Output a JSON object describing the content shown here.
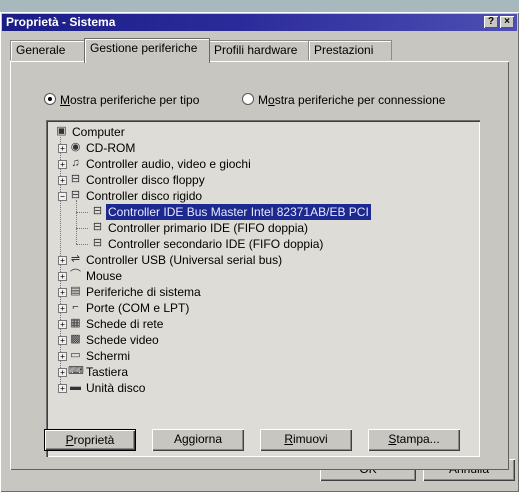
{
  "window": {
    "title": "Proprietà - Sistema",
    "help_glyph": "?",
    "close_glyph": "×"
  },
  "tabs": [
    {
      "label": "Generale"
    },
    {
      "label": "Gestione periferiche"
    },
    {
      "label": "Profili hardware"
    },
    {
      "label": "Prestazioni"
    }
  ],
  "view_options": {
    "by_type": {
      "prefix": "",
      "accel": "M",
      "rest": "ostra periferiche per tipo",
      "selected": true
    },
    "by_connection": {
      "prefix": "M",
      "accel": "o",
      "rest": "stra periferiche per connessione",
      "selected": false
    }
  },
  "tree": {
    "expand_glyph": "+",
    "collapse_glyph": "−",
    "root": {
      "label": "Computer",
      "icon": "computer-icon"
    },
    "items": [
      {
        "label": "CD-ROM",
        "icon": "cdrom-icon",
        "expanded": false
      },
      {
        "label": "Controller audio, video e giochi",
        "icon": "audio-video-controller-icon",
        "expanded": false
      },
      {
        "label": "Controller disco floppy",
        "icon": "floppy-controller-icon",
        "expanded": false
      },
      {
        "label": "Controller disco rigido",
        "icon": "hard-disk-controller-icon",
        "expanded": true,
        "children": [
          {
            "label": "Controller IDE Bus Master Intel 82371AB/EB PCI",
            "icon": "ide-controller-icon",
            "selected": true
          },
          {
            "label": "Controller primario IDE (FIFO doppia)",
            "icon": "ide-controller-icon"
          },
          {
            "label": "Controller secondario IDE (FIFO doppia)",
            "icon": "ide-controller-icon"
          }
        ]
      },
      {
        "label": "Controller USB (Universal serial bus)",
        "icon": "usb-icon",
        "expanded": false
      },
      {
        "label": "Mouse",
        "icon": "mouse-icon",
        "expanded": false
      },
      {
        "label": "Periferiche di sistema",
        "icon": "system-devices-icon",
        "expanded": false
      },
      {
        "label": "Porte (COM e LPT)",
        "icon": "ports-icon",
        "expanded": false
      },
      {
        "label": "Schede di rete",
        "icon": "network-card-icon",
        "expanded": false
      },
      {
        "label": "Schede video",
        "icon": "video-card-icon",
        "expanded": false
      },
      {
        "label": "Schermi",
        "icon": "monitor-icon",
        "expanded": false
      },
      {
        "label": "Tastiera",
        "icon": "keyboard-icon",
        "expanded": false
      },
      {
        "label": "Unità disco",
        "icon": "disk-drive-icon",
        "expanded": false
      }
    ]
  },
  "buttons": {
    "properties": {
      "accel": "P",
      "rest": "roprietà"
    },
    "refresh": {
      "accel": "",
      "rest": "Aggiorna"
    },
    "remove": {
      "accel": "R",
      "rest": "imuovi"
    },
    "print": {
      "accel": "S",
      "rest": "tampa..."
    }
  },
  "dialog_buttons": {
    "ok": "OK",
    "cancel": "Annulla"
  },
  "colors": {
    "titlebar": "#1a1d86",
    "selection": "#1c2a8f",
    "face": "#c8c6c0"
  }
}
